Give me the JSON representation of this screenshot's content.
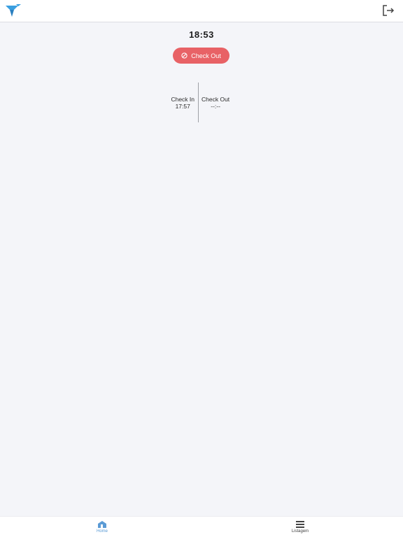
{
  "header": {
    "logo_icon": "brand-logo-icon",
    "logout_icon": "logout-icon"
  },
  "main": {
    "clock": "18:53",
    "checkout_button": {
      "label": "Check Out",
      "icon": "ban-circle-icon",
      "color": "#e86266"
    },
    "check_in": {
      "label": "Check In",
      "time": "17:57"
    },
    "check_out": {
      "label": "Check Out",
      "time": "--:--"
    }
  },
  "bottom_nav": {
    "items": [
      {
        "label": "Home",
        "icon": "home-icon",
        "active": true,
        "color": "#5b9bd5"
      },
      {
        "label": "Listagem",
        "icon": "list-icon",
        "active": false
      }
    ]
  }
}
